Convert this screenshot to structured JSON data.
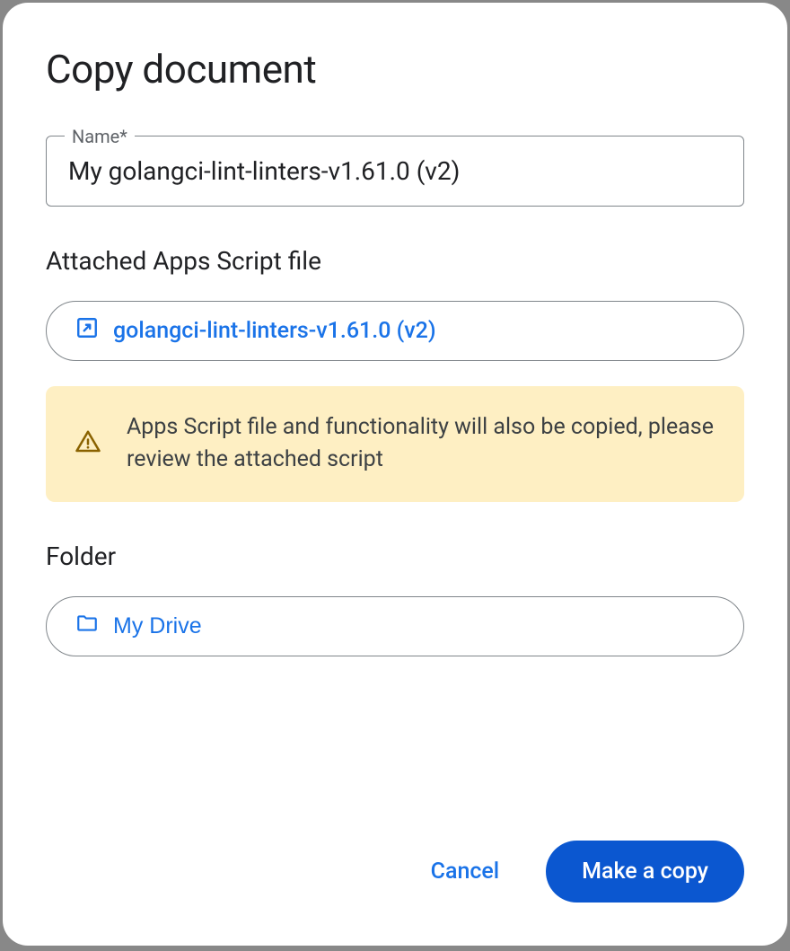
{
  "dialog": {
    "title": "Copy document",
    "name_field": {
      "label": "Name*",
      "value": "My golangci-lint-linters-v1.61.0 (v2)"
    },
    "attached_script": {
      "heading": "Attached Apps Script file",
      "link_text": "golangci-lint-linters-v1.61.0 (v2)",
      "warning": "Apps Script file and functionality will also be copied, please review the attached script"
    },
    "folder": {
      "heading": "Folder",
      "chip_text": "My Drive"
    },
    "actions": {
      "cancel": "Cancel",
      "confirm": "Make a copy"
    }
  }
}
